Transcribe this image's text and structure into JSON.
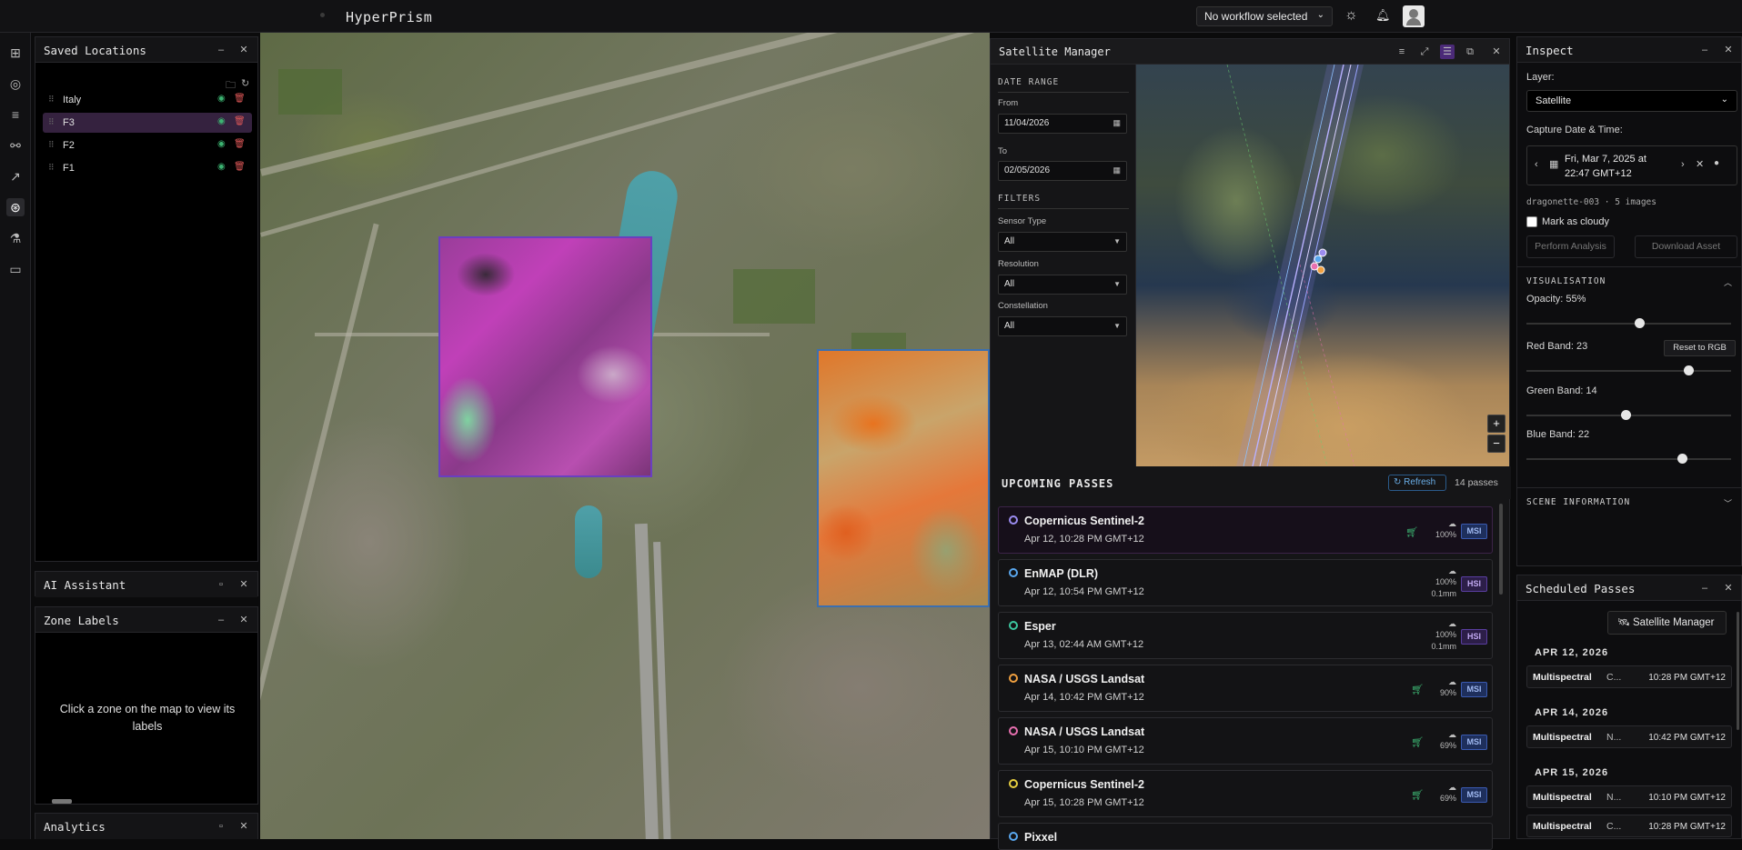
{
  "app": {
    "title": "HyperPrism",
    "workflow_select": "No workflow selected"
  },
  "icons": {
    "theme": "sun-icon",
    "notifications": "bell-icon",
    "user": "avatar"
  },
  "sidebar": {
    "items": [
      "map-icon",
      "pin-icon",
      "layers-icon",
      "nodes-icon",
      "trend-icon",
      "satellite-icon",
      "flask-icon",
      "chat-icon"
    ],
    "active_index": 5
  },
  "saved_locations": {
    "title": "Saved Locations",
    "items": [
      {
        "label": "Italy",
        "selected": false
      },
      {
        "label": "F3",
        "selected": true
      },
      {
        "label": "F2",
        "selected": false
      },
      {
        "label": "F1",
        "selected": false
      }
    ]
  },
  "ai_assistant": {
    "title": "AI Assistant"
  },
  "zone_labels": {
    "title": "Zone Labels",
    "empty_text": "Click a zone on the map to view its labels"
  },
  "analytics": {
    "title": "Analytics"
  },
  "satellite_manager": {
    "title": "Satellite Manager",
    "date_range": {
      "heading": "DATE RANGE",
      "from_label": "From",
      "from_value": "11/04/2026",
      "to_label": "To",
      "to_value": "02/05/2026"
    },
    "filters": {
      "heading": "FILTERS",
      "sensor_type": {
        "label": "Sensor Type",
        "value": "All"
      },
      "resolution": {
        "label": "Resolution",
        "value": "All"
      },
      "constellation": {
        "label": "Constellation",
        "value": "All"
      }
    },
    "zoom_in": "+",
    "zoom_out": "−",
    "upcoming": {
      "title": "UPCOMING PASSES",
      "refresh_label": "Refresh",
      "count_label": "14 passes",
      "passes": [
        {
          "name": "Copernicus Sentinel-2",
          "time": "Apr 12, 10:28 PM GMT+12",
          "cloud": "100%",
          "res": "",
          "badge": "MSI",
          "cart": true,
          "dot": "#9b8cf0"
        },
        {
          "name": "EnMAP (DLR)",
          "time": "Apr 12, 10:54 PM GMT+12",
          "cloud": "100%",
          "res": "0.1mm",
          "badge": "HSI",
          "cart": false,
          "dot": "#5aa8f0"
        },
        {
          "name": "Esper",
          "time": "Apr 13, 02:44 AM GMT+12",
          "cloud": "100%",
          "res": "0.1mm",
          "badge": "HSI",
          "cart": false,
          "dot": "#3cc8a0"
        },
        {
          "name": "NASA / USGS Landsat",
          "time": "Apr 14, 10:42 PM GMT+12",
          "cloud": "90%",
          "res": "",
          "badge": "MSI",
          "cart": true,
          "dot": "#f0a040"
        },
        {
          "name": "NASA / USGS Landsat",
          "time": "Apr 15, 10:10 PM GMT+12",
          "cloud": "69%",
          "res": "",
          "badge": "MSI",
          "cart": true,
          "dot": "#e870b0"
        },
        {
          "name": "Copernicus Sentinel-2",
          "time": "Apr 15, 10:28 PM GMT+12",
          "cloud": "69%",
          "res": "",
          "badge": "MSI",
          "cart": true,
          "dot": "#e8d040"
        },
        {
          "name": "Pixxel",
          "time": "",
          "cloud": "",
          "res": "",
          "badge": "",
          "cart": false,
          "dot": "#5aa8f0"
        }
      ]
    }
  },
  "inspect": {
    "title": "Inspect",
    "layer_label": "Layer:",
    "layer_value": "Satellite",
    "capture_label": "Capture Date & Time:",
    "capture_value_line1": "Fri, Mar 7, 2025 at",
    "capture_value_line2": "22:47 GMT+12",
    "sensor_line": "dragonette-003 · 5 images",
    "mark_cloudy": "Mark as cloudy",
    "perform_analysis": "Perform Analysis",
    "download_asset": "Download Asset",
    "visualisation": "VISUALISATION",
    "opacity_label": "Opacity: 55%",
    "opacity": 0.55,
    "red_label": "Red Band: 23",
    "red": 23,
    "green_label": "Green Band: 14",
    "green": 14,
    "blue_label": "Blue Band: 22",
    "blue": 22,
    "reset_rgb": "Reset to RGB",
    "scene_information": "SCENE INFORMATION"
  },
  "scheduled": {
    "title": "Scheduled Passes",
    "sm_button": "Satellite Manager",
    "groups": [
      {
        "date": "APR 12, 2026",
        "rows": [
          {
            "type": "Multispectral",
            "sat": "C...",
            "time": "10:28 PM GMT+12"
          }
        ]
      },
      {
        "date": "APR 14, 2026",
        "rows": [
          {
            "type": "Multispectral",
            "sat": "N...",
            "time": "10:42 PM GMT+12"
          }
        ]
      },
      {
        "date": "APR 15, 2026",
        "rows": [
          {
            "type": "Multispectral",
            "sat": "N...",
            "time": "10:10 PM GMT+12"
          },
          {
            "type": "Multispectral",
            "sat": "C...",
            "time": "10:28 PM GMT+12"
          }
        ]
      }
    ]
  }
}
